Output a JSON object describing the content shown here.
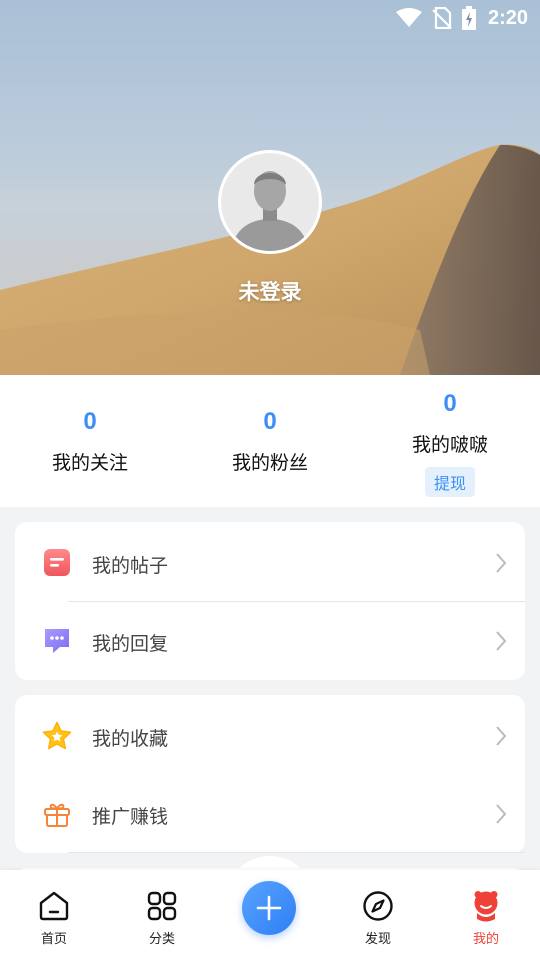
{
  "status_bar": {
    "time": "2:20",
    "icons": [
      "wifi-icon",
      "no-sim-icon",
      "battery-charging-icon"
    ]
  },
  "profile": {
    "name": "未登录",
    "avatar": "default-avatar-icon"
  },
  "stats": {
    "follow": {
      "count": "0",
      "label": "我的关注"
    },
    "fans": {
      "count": "0",
      "label": "我的粉丝"
    },
    "coins": {
      "count": "0",
      "label": "我的啵啵",
      "action": "提现"
    }
  },
  "menu": {
    "group1": [
      {
        "label": "我的帖子",
        "icon": "posts-icon"
      },
      {
        "label": "我的回复",
        "icon": "reply-icon"
      }
    ],
    "group2": [
      {
        "label": "我的收藏",
        "icon": "star-icon"
      },
      {
        "label": "推广赚钱",
        "icon": "gift-icon"
      }
    ]
  },
  "nav": {
    "home": "首页",
    "category": "分类",
    "discover": "发现",
    "mine": "我的",
    "active": "mine"
  },
  "colors": {
    "accent": "#3d8ef6",
    "active_tab": "#e8443a",
    "background": "#f2f3f5"
  }
}
